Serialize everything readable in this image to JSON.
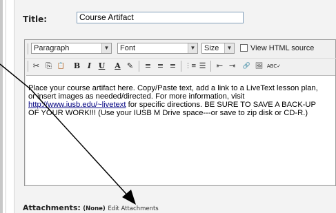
{
  "title_field": {
    "label": "Title:",
    "value": "Course Artifact"
  },
  "toolbar": {
    "paragraph_select": "Paragraph",
    "font_select": "Font",
    "size_select": "Size",
    "view_html_label": "View HTML source",
    "buttons": {
      "cut": "✂",
      "copy": "⎘",
      "paste": "📋",
      "bold": "B",
      "italic": "I",
      "underline": "U",
      "text_color": "A",
      "highlight": "✎",
      "align_left": "≡",
      "align_center": "≡",
      "align_right": "≡",
      "ordered_list": "⋮≡",
      "unordered_list": "☰",
      "outdent": "⇤",
      "indent": "⇥",
      "link": "🔗",
      "image": "🖼",
      "spellcheck": "ABC✓"
    }
  },
  "editor_text": {
    "line1": "Place your course artifact here.  Copy/Paste text, add a link to a LiveText lesson plan,",
    "line2": "or insert images as needed/directed.  For more information, visit",
    "link": "http://www.iusb.edu/~livetext",
    "line3_rest": " for specific directions.  BE SURE TO SAVE A BACK-UP",
    "line4": "OF YOUR WORK!!!  (Use your IUSB M Drive space---or save to zip disk or CD-R.)"
  },
  "attachments": {
    "label": "Attachments:",
    "status": "(None)",
    "edit_label": "Edit Attachments"
  },
  "colors": {
    "link": "#000080",
    "panel_bg": "#f3f3f3",
    "arrow": "#000000"
  }
}
